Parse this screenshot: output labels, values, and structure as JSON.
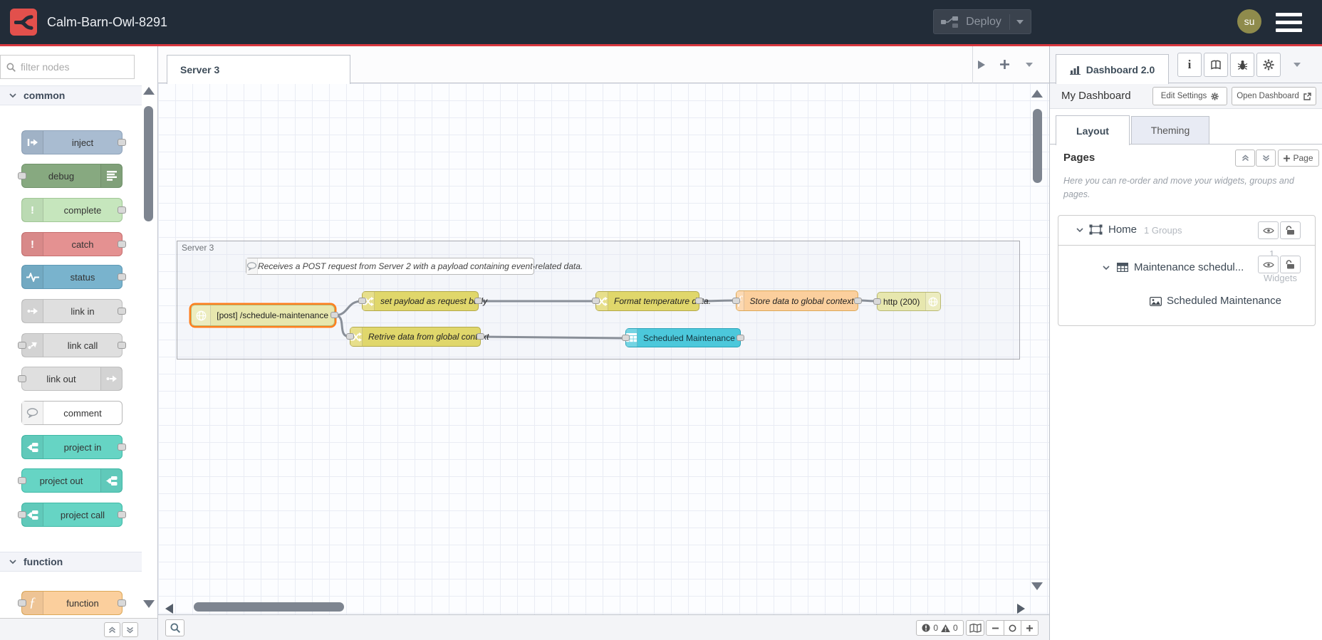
{
  "colors": {
    "header_bg": "#222c38",
    "accent_red": "#d9383f",
    "logo_red": "#e2504c",
    "node_inject": "#a9bcd1",
    "node_debug": "#87a980",
    "node_complete": "#c6e6bd",
    "node_catch": "#e49191",
    "node_status": "#79b3cd",
    "node_link": "#dfdfdf",
    "node_comment": "#ffffff",
    "node_project": "#66d4c4",
    "node_function": "#fbcf9d",
    "node_http": "#e7e7ae",
    "node_change": "#e0d76b",
    "node_table": "#4cc8db",
    "selected_outline": "#ff7f1e",
    "wire": "#888888",
    "avatar_bg": "#8f8b4c"
  },
  "header": {
    "title": "Calm-Barn-Owl-8291",
    "deploy_label": "Deploy",
    "avatar_text": "su"
  },
  "palette": {
    "filter_placeholder": "filter nodes",
    "categories": [
      {
        "label": "common",
        "nodes": [
          {
            "label": "inject"
          },
          {
            "label": "debug"
          },
          {
            "label": "complete"
          },
          {
            "label": "catch"
          },
          {
            "label": "status"
          },
          {
            "label": "link in"
          },
          {
            "label": "link call"
          },
          {
            "label": "link out"
          },
          {
            "label": "comment"
          },
          {
            "label": "project in"
          },
          {
            "label": "project out"
          },
          {
            "label": "project call"
          }
        ]
      },
      {
        "label": "function",
        "nodes": [
          {
            "label": "function"
          }
        ]
      }
    ]
  },
  "workspace": {
    "tab_label": "Server 3",
    "group_label": "Server 3",
    "comment_text": "Receives a POST request from Server 2 with a payload containing event-related data.",
    "nodes": {
      "http_in": "[post] /schedule-maintenance",
      "set_payload": "set payload as request body",
      "format_temp": "Format temperature data.",
      "store_data": "Store data to global context",
      "http_response": "http (200)",
      "retrieve_data": "Retrive data from global context",
      "table_widget": "Scheduled Maintenance"
    },
    "footer": {
      "error_count": "0",
      "warning_count": "0"
    }
  },
  "sidebar": {
    "tab_label": "Dashboard 2.0",
    "dashboard_title": "My Dashboard",
    "edit_settings_label": "Edit Settings",
    "open_dashboard_label": "Open Dashboard",
    "layout_tab": "Layout",
    "theming_tab": "Theming",
    "pages_heading": "Pages",
    "add_page_label": "Page",
    "help_text": "Here you can re-order and move your widgets, groups and pages.",
    "tree": {
      "page_name": "Home",
      "page_meta": "1 Groups",
      "group_name": "Maintenance schedul...",
      "group_count": "1",
      "group_count_label": "Widgets",
      "widget_name": "Scheduled Maintenance"
    }
  },
  "glyphs": {
    "exclamation": "!",
    "function": "ƒ",
    "info": "i"
  }
}
